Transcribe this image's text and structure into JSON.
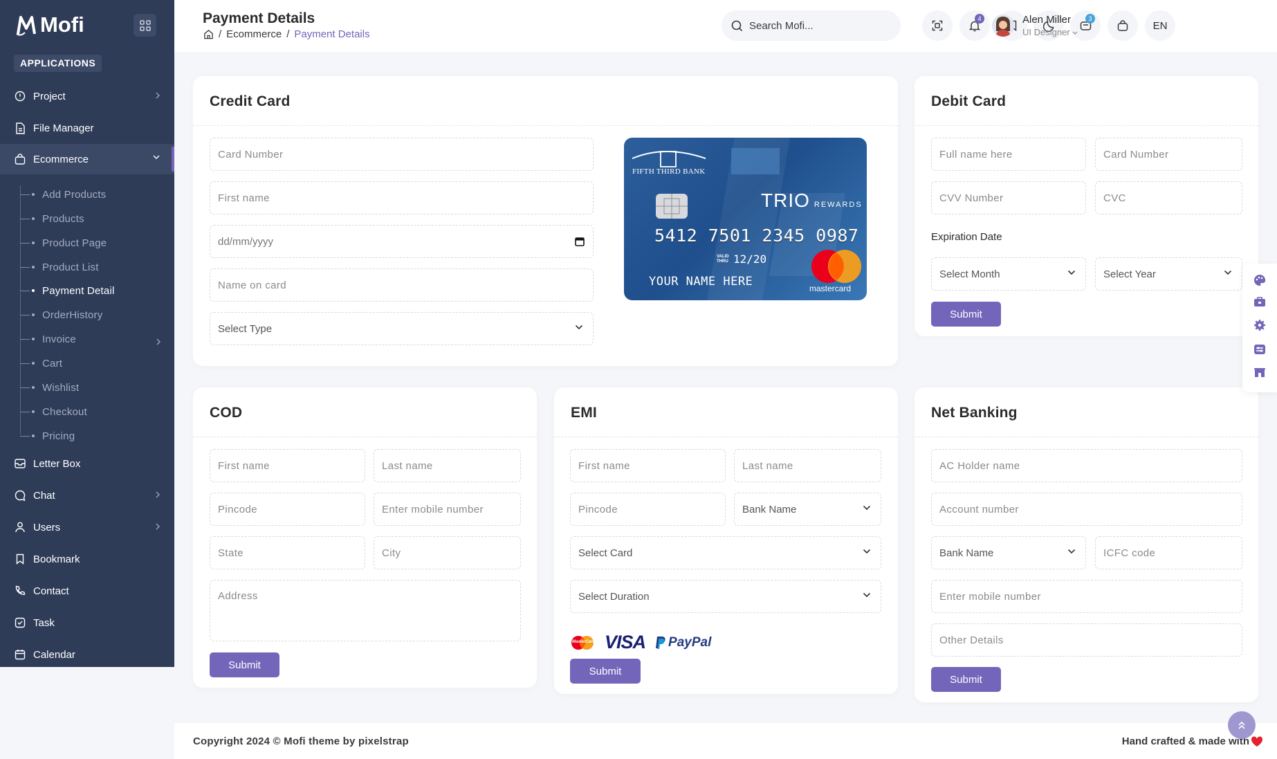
{
  "brand": {
    "name": "Mofi"
  },
  "sidebar": {
    "section_label": "APPLICATIONS",
    "items": [
      {
        "label": "Project"
      },
      {
        "label": "File Manager"
      },
      {
        "label": "Ecommerce"
      },
      {
        "label": "Letter Box"
      },
      {
        "label": "Chat"
      },
      {
        "label": "Users"
      },
      {
        "label": "Bookmark"
      },
      {
        "label": "Contact"
      },
      {
        "label": "Task"
      },
      {
        "label": "Calendar"
      }
    ],
    "subitems": [
      {
        "label": "Add Products"
      },
      {
        "label": "Products"
      },
      {
        "label": "Product Page"
      },
      {
        "label": "Product List"
      },
      {
        "label": "Payment Detail"
      },
      {
        "label": "OrderHistory"
      },
      {
        "label": "Invoice"
      },
      {
        "label": "Cart"
      },
      {
        "label": "Wishlist"
      },
      {
        "label": "Checkout"
      },
      {
        "label": "Pricing"
      }
    ]
  },
  "header": {
    "title": "Payment Details",
    "breadcrumb": [
      "Ecommerce",
      "Payment Details"
    ],
    "search_placeholder": "Search Mofi...",
    "notifications_count": "4",
    "messages_count": "3",
    "language": "EN",
    "user": {
      "name": "Alen Miller",
      "role": "UI Designer"
    }
  },
  "credit_card": {
    "title": "Credit Card",
    "card_number_placeholder": "Card Number",
    "first_name_placeholder": "First name",
    "date_placeholder": "dd/mm/yyyy",
    "name_on_card_placeholder": "Name on card",
    "type_select": "Select Type",
    "card_image": {
      "bank": "FIFTH THIRD BANK",
      "product": "TRIO",
      "product_suffix": "REWARDS",
      "number": "5412 7501 2345 0987",
      "valid_label": "VALID THRU",
      "expiry": "12/20",
      "holder": "YOUR NAME HERE",
      "network": "mastercard"
    }
  },
  "debit_card": {
    "title": "Debit Card",
    "full_name_placeholder": "Full name here",
    "card_number_placeholder": "Card Number",
    "cvv_placeholder": "CVV Number",
    "cvc_placeholder": "CVC",
    "expiration_label": "Expiration Date",
    "month_select": "Select Month",
    "year_select": "Select Year",
    "submit_label": "Submit"
  },
  "cod": {
    "title": "COD",
    "first_name_placeholder": "First name",
    "last_name_placeholder": "Last name",
    "pincode_placeholder": "Pincode",
    "mobile_placeholder": "Enter mobile number",
    "state_placeholder": "State",
    "city_placeholder": "City",
    "address_placeholder": "Address",
    "submit_label": "Submit"
  },
  "emi": {
    "title": "EMI",
    "first_name_placeholder": "First name",
    "last_name_placeholder": "Last name",
    "pincode_placeholder": "Pincode",
    "bank_select": "Bank Name",
    "card_select": "Select Card",
    "duration_select": "Select Duration",
    "payment_logos": [
      "MasterCard",
      "VISA",
      "PayPal"
    ],
    "submit_label": "Submit"
  },
  "net_banking": {
    "title": "Net Banking",
    "holder_placeholder": "AC Holder name",
    "account_placeholder": "Account number",
    "bank_select": "Bank Name",
    "icfc_placeholder": "ICFC code",
    "mobile_placeholder": "Enter mobile number",
    "other_placeholder": "Other Details",
    "submit_label": "Submit"
  },
  "footer": {
    "copyright": "Copyright 2024 © Mofi theme by pixelstrap",
    "crafted": "Hand crafted & made with"
  },
  "colors": {
    "accent": "#7366ba",
    "sidebar": "#2f3c58",
    "badge_notify": "#7366ba",
    "badge_msg": "#48a3d7"
  }
}
